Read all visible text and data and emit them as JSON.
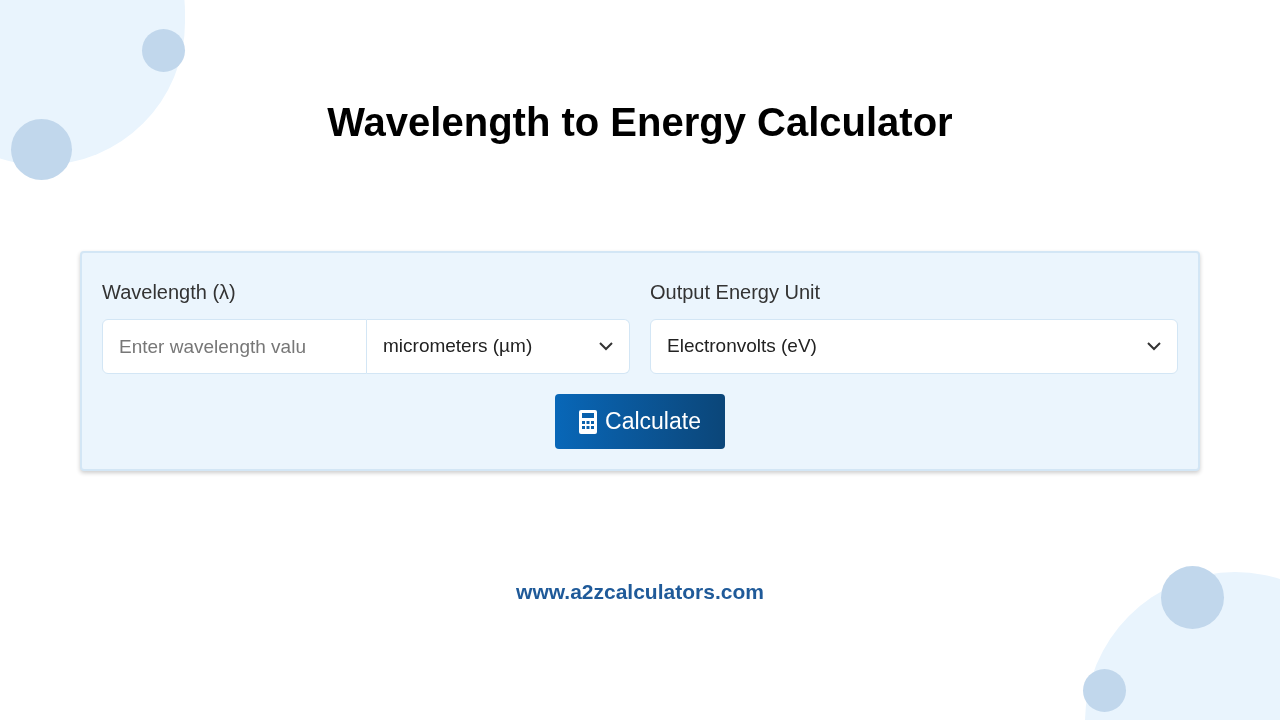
{
  "title": "Wavelength to Energy Calculator",
  "form": {
    "wavelength_label": "Wavelength (λ)",
    "wavelength_input": {
      "placeholder": "Enter wavelength valu"
    },
    "unit_select": {
      "value": "micrometers (µm)"
    },
    "energy_label": "Output Energy Unit",
    "energy_select": {
      "value": "Electronvolts (eV)"
    },
    "button": "Calculate"
  },
  "footer": "www.a2zcalculators.com"
}
